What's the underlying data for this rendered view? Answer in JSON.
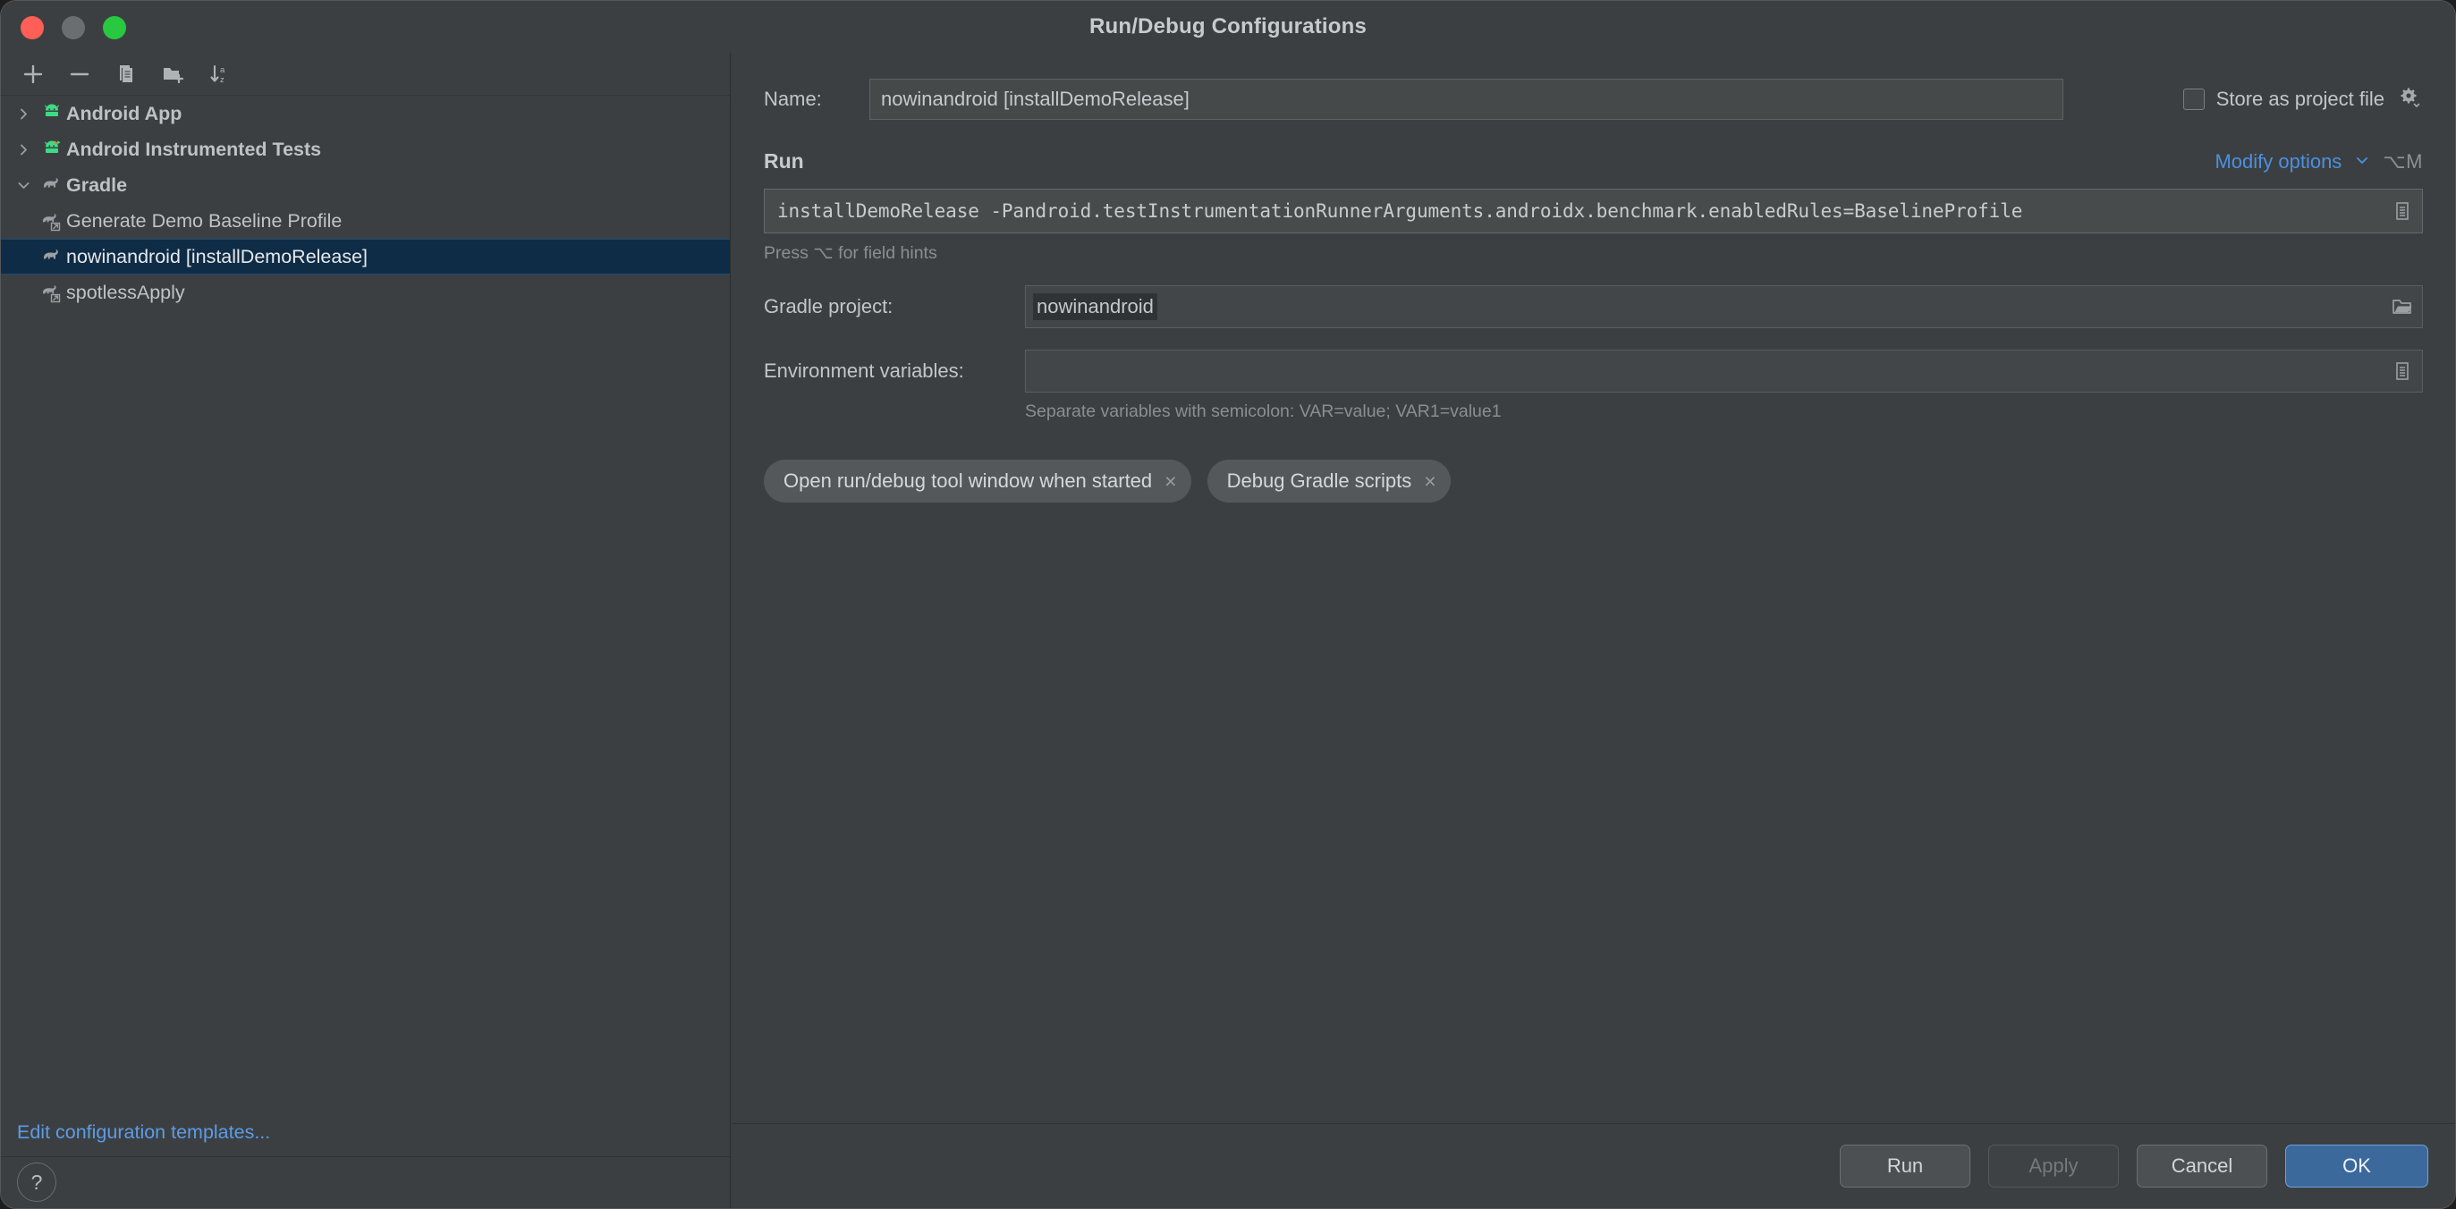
{
  "window": {
    "title": "Run/Debug Configurations",
    "traffic_lights": [
      "close",
      "minimize",
      "zoom"
    ]
  },
  "left_panel": {
    "toolbar": [
      {
        "name": "add-configuration-button",
        "icon": "plus-icon"
      },
      {
        "name": "remove-configuration-button",
        "icon": "minus-icon"
      },
      {
        "name": "copy-configuration-button",
        "icon": "copy-icon"
      },
      {
        "name": "new-folder-button",
        "icon": "folder-add-icon"
      },
      {
        "name": "sort-alphabetically-button",
        "icon": "sort-az-icon"
      }
    ],
    "tree": [
      {
        "label": "Android App",
        "icon": "android-robot-icon",
        "type": "group",
        "expanded": false,
        "selected": false
      },
      {
        "label": "Android Instrumented Tests",
        "icon": "android-robot-test-icon",
        "type": "group",
        "expanded": false,
        "selected": false
      },
      {
        "label": "Gradle",
        "icon": "gradle-elephant-icon",
        "type": "group",
        "expanded": true,
        "selected": false
      },
      {
        "label": "Generate Demo Baseline Profile",
        "icon": "gradle-elephant-icon",
        "type": "child",
        "selected": false
      },
      {
        "label": "nowinandroid [installDemoRelease]",
        "icon": "gradle-elephant-icon",
        "type": "child",
        "selected": true
      },
      {
        "label": "spotlessApply",
        "icon": "gradle-elephant-icon",
        "type": "child",
        "selected": false
      }
    ],
    "edit_templates_link": "Edit configuration templates...",
    "help_button": "?"
  },
  "form": {
    "name_label": "Name:",
    "name_value": "nowinandroid [installDemoRelease]",
    "store_as_project_file_label": "Store as project file",
    "store_as_project_file_checked": false,
    "store_gear_icon": "gear-dropdown-icon",
    "run_section_title": "Run",
    "modify_options_label": "Modify options",
    "modify_options_shortcut": "⌥M",
    "command_value": "installDemoRelease -Pandroid.testInstrumentationRunnerArguments.androidx.benchmark.enabledRules=BaselineProfile",
    "command_expand_icon": "expand-editor-icon",
    "field_hints_text": "Press ⌥ for field hints",
    "gradle_project_label": "Gradle project:",
    "gradle_project_value": "nowinandroid",
    "gradle_project_browse_icon": "folder-icon",
    "environment_variables_label": "Environment variables:",
    "environment_variables_value": "",
    "environment_variables_icon": "expand-editor-icon",
    "environment_hint": "Separate variables with semicolon: VAR=value; VAR1=value1",
    "tags": [
      {
        "label": "Open run/debug tool window when started",
        "close": "×"
      },
      {
        "label": "Debug Gradle scripts",
        "close": "×"
      }
    ]
  },
  "buttons": {
    "run": "Run",
    "apply": "Apply",
    "apply_disabled": true,
    "cancel": "Cancel",
    "ok": "OK"
  },
  "colors": {
    "window_bg": "#3c3f41",
    "selection_blue": "#0f2c46",
    "link_blue": "#5c9ce6",
    "primary_button": "#3c699c",
    "android_green": "#3ddc84"
  }
}
